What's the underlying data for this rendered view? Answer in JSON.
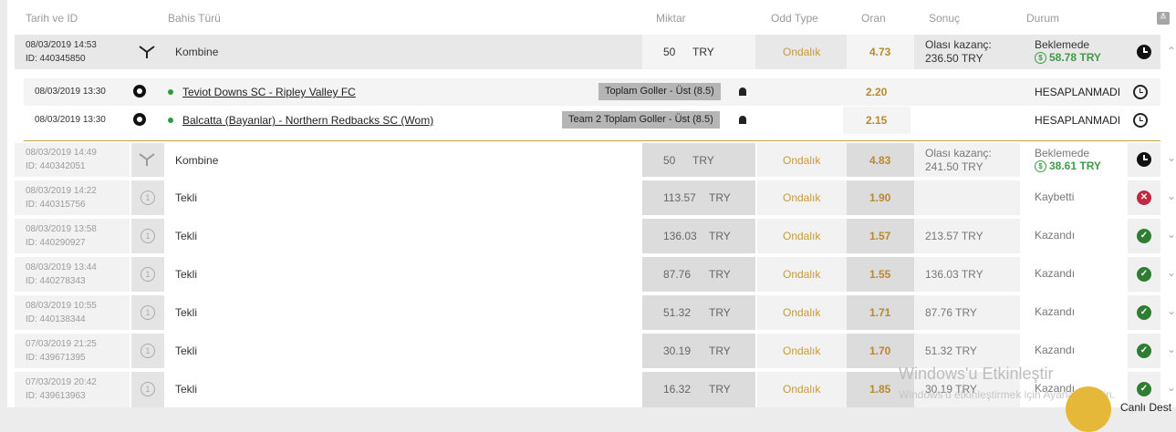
{
  "header": {
    "date_id": "Tarih ve ID",
    "bet_type": "Bahis Türü",
    "amount": "Miktar",
    "odd_type": "Odd Type",
    "odds": "Oran",
    "result": "Sonuç",
    "status": "Durum",
    "collapse_icon": "double-chevron-down-icon"
  },
  "colors": {
    "gold": "#b8892e",
    "green": "#2e7d32",
    "red": "#c0293e",
    "bonus": "#3e9b48"
  },
  "bets": [
    {
      "date": "08/03/2019 14:53",
      "id": "ID: 440345850",
      "type": "Kombine",
      "icon": "combo-icon",
      "amount": "50",
      "currency": "TRY",
      "odd_type": "Ondalık",
      "odds": "4.73",
      "result_label": "Olası kazanç:",
      "result_value": "236.50 TRY",
      "status": "Beklemede",
      "bonus": "58.78 TRY",
      "status_icon": "clock-icon",
      "expanded": true,
      "selections": [
        {
          "date": "08/03/2019 13:30",
          "match": "Teviot Downs SC - Ripley Valley FC",
          "market": "Toplam Goller - Üst (8.5)",
          "odds": "2.20",
          "status": "HESAPLANMADI"
        },
        {
          "date": "08/03/2019 13:30",
          "match": "Balcatta (Bayanlar) - Northern Redbacks SC (Wom)",
          "market": "Team 2 Toplam Goller - Üst (8.5)",
          "odds": "2.15",
          "status": "HESAPLANMADI"
        }
      ]
    },
    {
      "date": "08/03/2019 14:49",
      "id": "ID: 440342051",
      "type": "Kombine",
      "icon": "combo-icon",
      "amount": "50",
      "currency": "TRY",
      "odd_type": "Ondalık",
      "odds": "4.83",
      "result_label": "Olası kazanç:",
      "result_value": "241.50 TRY",
      "status": "Beklemede",
      "bonus": "38.61 TRY",
      "status_icon": "clock-icon"
    },
    {
      "date": "08/03/2019 14:22",
      "id": "ID: 440315756",
      "type": "Tekli",
      "icon": "single-icon",
      "amount": "113.57",
      "currency": "TRY",
      "odd_type": "Ondalık",
      "odds": "1.90",
      "result_value": "",
      "status": "Kaybetti",
      "status_icon": "lost-icon"
    },
    {
      "date": "08/03/2019 13:58",
      "id": "ID: 440290927",
      "type": "Tekli",
      "icon": "single-icon",
      "amount": "136.03",
      "currency": "TRY",
      "odd_type": "Ondalık",
      "odds": "1.57",
      "result_value": "213.57 TRY",
      "status": "Kazandı",
      "status_icon": "won-icon"
    },
    {
      "date": "08/03/2019 13:44",
      "id": "ID: 440278343",
      "type": "Tekli",
      "icon": "single-icon",
      "amount": "87.76",
      "currency": "TRY",
      "odd_type": "Ondalık",
      "odds": "1.55",
      "result_value": "136.03 TRY",
      "status": "Kazandı",
      "status_icon": "won-icon"
    },
    {
      "date": "08/03/2019 10:55",
      "id": "ID: 440138344",
      "type": "Tekli",
      "icon": "single-icon",
      "amount": "51.32",
      "currency": "TRY",
      "odd_type": "Ondalık",
      "odds": "1.71",
      "result_value": "87.76 TRY",
      "status": "Kazandı",
      "status_icon": "won-icon"
    },
    {
      "date": "07/03/2019 21:25",
      "id": "ID: 439671395",
      "type": "Tekli",
      "icon": "single-icon",
      "amount": "30.19",
      "currency": "TRY",
      "odd_type": "Ondalık",
      "odds": "1.70",
      "result_value": "51.32 TRY",
      "status": "Kazandı",
      "status_icon": "won-icon"
    },
    {
      "date": "07/03/2019 20:42",
      "id": "ID: 439613963",
      "type": "Tekli",
      "icon": "single-icon",
      "amount": "16.32",
      "currency": "TRY",
      "odd_type": "Ondalık",
      "odds": "1.85",
      "result_value": "30.19 TRY",
      "status": "Kazandı",
      "status_icon": "won-icon"
    }
  ],
  "overlay": {
    "watermark_title": "Windows'u Etkinleştir",
    "watermark_sub": "Windows'u etkinleştirmek için Ayarlar'a gidin.",
    "chat_label": "Canlı Dest"
  }
}
